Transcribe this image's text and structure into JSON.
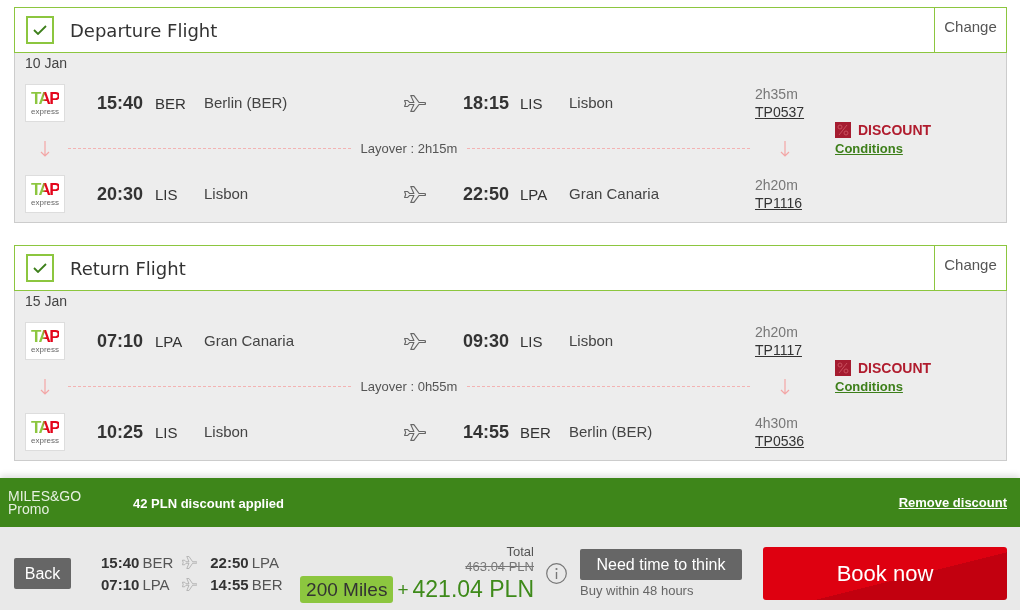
{
  "flights": [
    {
      "title": "Departure Flight",
      "checked": true,
      "change": "Change",
      "date": "10 Jan",
      "segments": [
        {
          "logo": "TAP",
          "logo_sub": "express",
          "dep_time": "15:40",
          "dep_code": "BER",
          "dep_city": "Berlin (BER)",
          "arr_time": "18:15",
          "arr_code": "LIS",
          "arr_city": "Lisbon",
          "duration": "2h35m",
          "flight_no": "TP0537"
        },
        {
          "logo": "TAP",
          "logo_sub": "express",
          "dep_time": "20:30",
          "dep_code": "LIS",
          "dep_city": "Lisbon",
          "arr_time": "22:50",
          "arr_code": "LPA",
          "arr_city": "Gran Canaria",
          "duration": "2h20m",
          "flight_no": "TP1116"
        }
      ],
      "layovers": [
        "Layover : 2h15m"
      ],
      "discount": {
        "label": "DISCOUNT",
        "link": "Conditions"
      }
    },
    {
      "title": "Return Flight",
      "checked": true,
      "change": "Change",
      "date": "15 Jan",
      "segments": [
        {
          "logo": "TAP",
          "logo_sub": "express",
          "dep_time": "07:10",
          "dep_code": "LPA",
          "dep_city": "Gran Canaria",
          "arr_time": "09:30",
          "arr_code": "LIS",
          "arr_city": "Lisbon",
          "duration": "2h20m",
          "flight_no": "TP1117"
        },
        {
          "logo": "TAP",
          "logo_sub": "express",
          "dep_time": "10:25",
          "dep_code": "LIS",
          "dep_city": "Lisbon",
          "arr_time": "14:55",
          "arr_code": "BER",
          "arr_city": "Berlin (BER)",
          "duration": "4h30m",
          "flight_no": "TP0536"
        }
      ],
      "layovers": [
        "Layover : 0h55m"
      ],
      "discount": {
        "label": "DISCOUNT",
        "link": "Conditions"
      }
    }
  ],
  "promo": {
    "brand": "MILES&GO",
    "brand_sub": "Promo",
    "message": "42 PLN discount applied",
    "remove": "Remove discount"
  },
  "footer": {
    "back": "Back",
    "journeys": [
      {
        "dep_time": "15:40",
        "dep_code": "BER",
        "arr_time": "22:50",
        "arr_code": "LPA"
      },
      {
        "dep_time": "07:10",
        "dep_code": "LPA",
        "arr_time": "14:55",
        "arr_code": "BER"
      }
    ],
    "total_label": "Total",
    "old_price": "463.04 PLN",
    "miles": "200 Miles",
    "plus": "+",
    "price": "421.04 PLN",
    "hold": "Need time to think",
    "hold_note": "Buy within 48 hours",
    "book": "Book now"
  }
}
